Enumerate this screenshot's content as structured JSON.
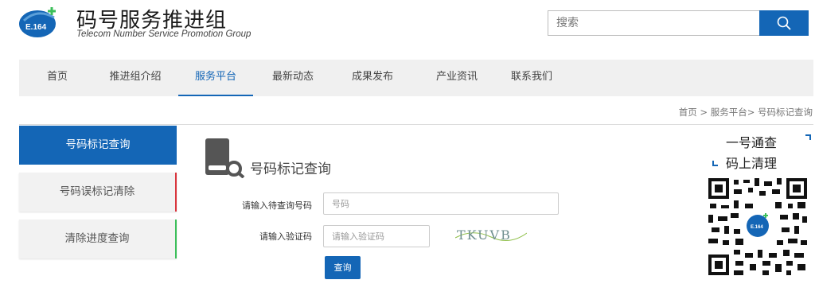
{
  "header": {
    "logo_text": "E.164",
    "title": "码号服务推进组",
    "subtitle": "Telecom Number Service Promotion Group"
  },
  "search": {
    "placeholder": "搜索",
    "icon": "search-icon"
  },
  "nav": {
    "items": [
      {
        "label": "首页"
      },
      {
        "label": "推进组介绍"
      },
      {
        "label": "服务平台",
        "active": true
      },
      {
        "label": "最新动态"
      },
      {
        "label": "成果发布"
      },
      {
        "label": "产业资讯"
      },
      {
        "label": "联系我们"
      }
    ]
  },
  "breadcrumb": "首页 > 服务平台> 号码标记查询",
  "sidebar": {
    "items": [
      {
        "label": "号码标记查询",
        "active": true
      },
      {
        "label": "号码误标记清除",
        "accent": "#d9363e"
      },
      {
        "label": "清除进度查询",
        "accent": "#3cbf5a"
      }
    ]
  },
  "main": {
    "title": "号码标记查询",
    "icon": "book-search-icon",
    "form": {
      "number_label": "请输入待查询号码",
      "number_placeholder": "号码",
      "code_label": "请输入验证码",
      "code_placeholder": "请输入验证码",
      "captcha_text": "TKUVB",
      "submit_label": "查询"
    }
  },
  "promo": {
    "line1": "一号通查",
    "line2": "码上清理"
  },
  "colors": {
    "brand": "#1466b6",
    "nav_bg": "#f0f0f0",
    "red_accent": "#d9363e",
    "green_accent": "#3cbf5a"
  }
}
